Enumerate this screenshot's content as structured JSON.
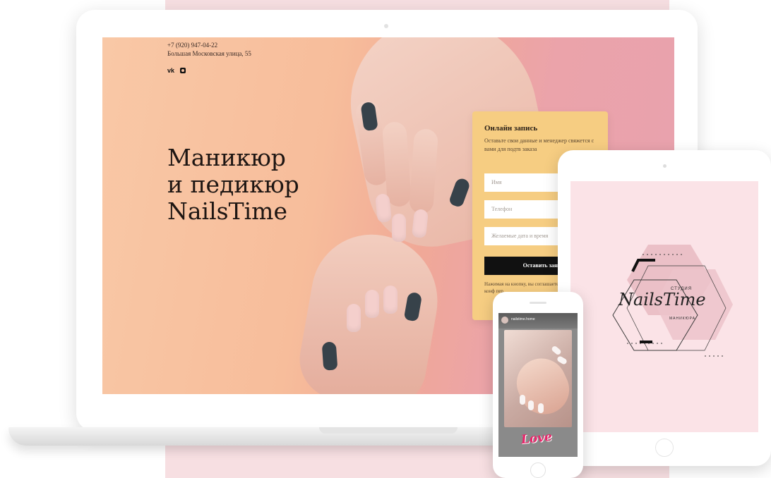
{
  "site": {
    "phone": "+7 (920) 947-04-22",
    "address": "Большая Московская улица, 55",
    "social": {
      "vk_label": "vk",
      "icons": [
        "vk-icon",
        "instagram-icon"
      ]
    },
    "hero": {
      "line1": "Маникюр",
      "line2": "и педикюр",
      "line3": "NailsTime"
    }
  },
  "form": {
    "title": "Онлайн запись",
    "description": "Оставьте свои данные и менеджер свяжется с вами для подтв заказа",
    "name_placeholder": "Имя",
    "phone_placeholder": "Телефон",
    "date_placeholder": "Желаемые дата и время",
    "submit_label": "Оставить заяв",
    "consent": "Нажимая на кнопку, вы соглашаетесь с нашей по конф пер"
  },
  "tablet": {
    "logo_top": "СТУДИЯ",
    "logo_name": "NailsTime",
    "logo_bottom": "МАНИКЮРА"
  },
  "phone_story": {
    "username": "nailstime.home",
    "sticker": "Love"
  },
  "colors": {
    "background_band": "#f7dfe2",
    "form_card": "#f6cd82",
    "submit_button": "#111111",
    "sticker": "#e8266b"
  }
}
